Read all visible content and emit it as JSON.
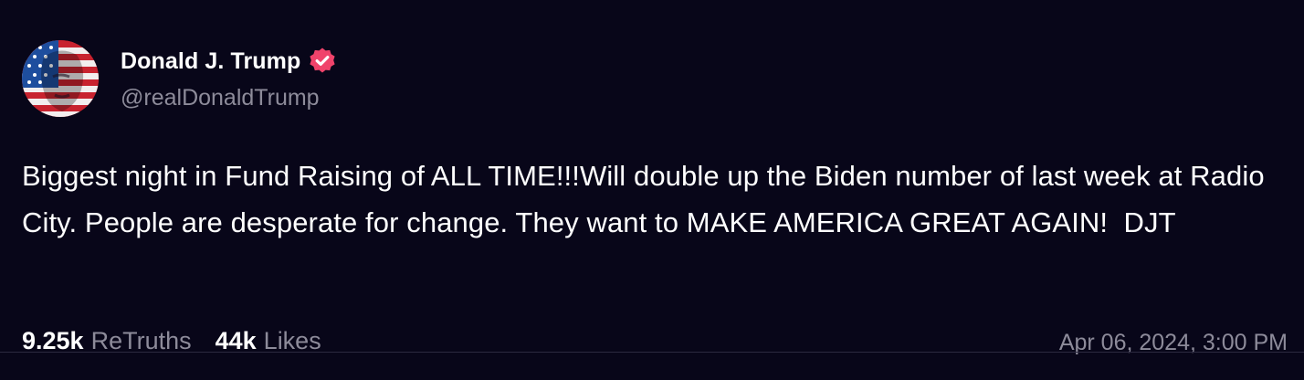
{
  "post": {
    "author": {
      "display_name": "Donald J. Trump",
      "handle": "@realDonaldTrump",
      "verified": true,
      "avatar_icon": "flag-portrait-avatar"
    },
    "content": "Biggest night in Fund Raising of ALL TIME!!!Will double up the Biden number of last week at Radio City. People are desperate for change. They want to MAKE AMERICA GREAT AGAIN!  DJT",
    "stats": {
      "retruths_value": "9.25k",
      "retruths_label": "ReTruths",
      "likes_value": "44k",
      "likes_label": "Likes"
    },
    "timestamp": "Apr 06, 2024, 3:00 PM"
  },
  "colors": {
    "background": "#080619",
    "text_primary": "#ffffff",
    "text_secondary": "#8d8b9a",
    "verified_badge": "#f0436b"
  }
}
